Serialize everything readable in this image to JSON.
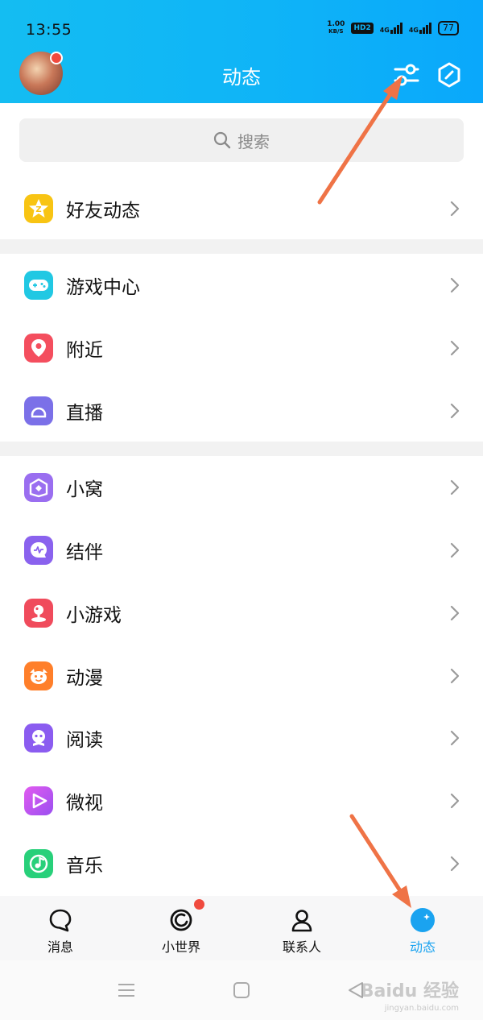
{
  "status_bar": {
    "time": "13:55",
    "speed_value": "1.00",
    "speed_unit": "KB/S",
    "hd": "HD2",
    "net1": "4G",
    "net2": "4G",
    "battery": "77"
  },
  "header": {
    "title": "动态"
  },
  "search": {
    "placeholder": "搜索"
  },
  "rows": {
    "friends": "好友动态",
    "game_center": "游戏中心",
    "nearby": "附近",
    "live": "直播",
    "xiaowo": "小窝",
    "jieban": "结伴",
    "mini_games": "小游戏",
    "anime": "动漫",
    "reading": "阅读",
    "weishi": "微视",
    "music": "音乐"
  },
  "tabs": {
    "messages": "消息",
    "small_world": "小世界",
    "contacts": "联系人",
    "feed": "动态"
  },
  "watermark": {
    "brand": "Baidu 经验",
    "url": "jingyan.baidu.com"
  },
  "colors": {
    "header": "#0fb4f7",
    "accent": "#1aa3f0",
    "annotation": "#ef7346",
    "badge": "#f04a3e"
  }
}
